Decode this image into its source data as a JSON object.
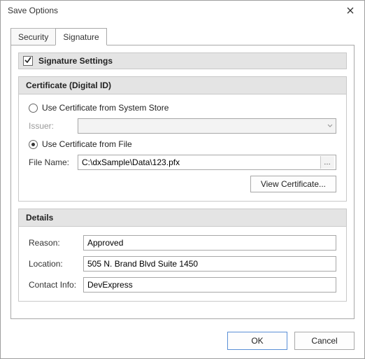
{
  "window": {
    "title": "Save Options"
  },
  "tabs": {
    "security": "Security",
    "signature": "Signature"
  },
  "settings": {
    "header": "Signature Settings",
    "checked": true
  },
  "certificate": {
    "group_title": "Certificate (Digital ID)",
    "radio_system": "Use Certificate from System Store",
    "issuer_label": "Issuer:",
    "issuer_value": "",
    "radio_file": "Use Certificate from File",
    "filename_label": "File Name:",
    "filename_value": "C:\\dxSample\\Data\\123.pfx",
    "view_cert": "View Certificate..."
  },
  "details": {
    "group_title": "Details",
    "reason_label": "Reason:",
    "reason_value": "Approved",
    "location_label": "Location:",
    "location_value": "505 N. Brand Blvd Suite 1450",
    "contact_label": "Contact Info:",
    "contact_value": "DevExpress"
  },
  "footer": {
    "ok": "OK",
    "cancel": "Cancel"
  }
}
